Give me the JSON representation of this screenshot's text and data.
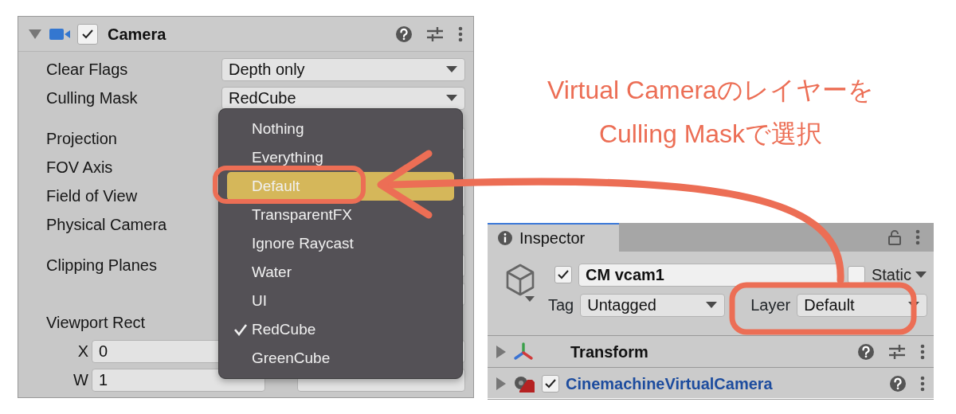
{
  "camera_component": {
    "title": "Camera",
    "enabled": true,
    "expanded": true,
    "properties": [
      {
        "label": "Clear Flags",
        "kind": "dropdown",
        "value": "Depth only"
      },
      {
        "label": "Culling Mask",
        "kind": "dropdown",
        "value": "RedCube"
      },
      {
        "label": "Projection",
        "kind": "covered"
      },
      {
        "label": "FOV Axis",
        "kind": "covered"
      },
      {
        "label": "Field of View",
        "kind": "covered"
      },
      {
        "label": "Physical Camera",
        "kind": "covered"
      },
      {
        "label": "Clipping Planes",
        "kind": "covered_pair"
      },
      {
        "label": "Viewport Rect",
        "kind": "label"
      }
    ],
    "viewport_fields": [
      {
        "axis": "X",
        "value": "0"
      },
      {
        "axis": "W",
        "value": "1"
      }
    ]
  },
  "culling_menu": {
    "items": [
      {
        "label": "Nothing",
        "selected": false,
        "checked": false
      },
      {
        "label": "Everything",
        "selected": false,
        "checked": false
      },
      {
        "label": "Default",
        "selected": true,
        "checked": false
      },
      {
        "label": "TransparentFX",
        "selected": false,
        "checked": false
      },
      {
        "label": "Ignore Raycast",
        "selected": false,
        "checked": false
      },
      {
        "label": "Water",
        "selected": false,
        "checked": false
      },
      {
        "label": "UI",
        "selected": false,
        "checked": false
      },
      {
        "label": "RedCube",
        "selected": false,
        "checked": true
      },
      {
        "label": "GreenCube",
        "selected": false,
        "checked": false
      }
    ]
  },
  "annotation": {
    "caption_lines": [
      "Virtual Cameraのレイヤーを",
      "Culling Maskで選択"
    ]
  },
  "inspector": {
    "tab": "Inspector",
    "object": {
      "active": true,
      "name": "CM vcam1",
      "static": false,
      "static_label": "Static",
      "tag_label": "Tag",
      "tag": "Untagged",
      "layer_label": "Layer",
      "layer": "Default"
    },
    "components": [
      {
        "name": "Transform",
        "kind": "transform",
        "expanded": false
      },
      {
        "name": "CinemachineVirtualCamera",
        "kind": "script",
        "enabled": true,
        "expanded": false
      }
    ]
  }
}
